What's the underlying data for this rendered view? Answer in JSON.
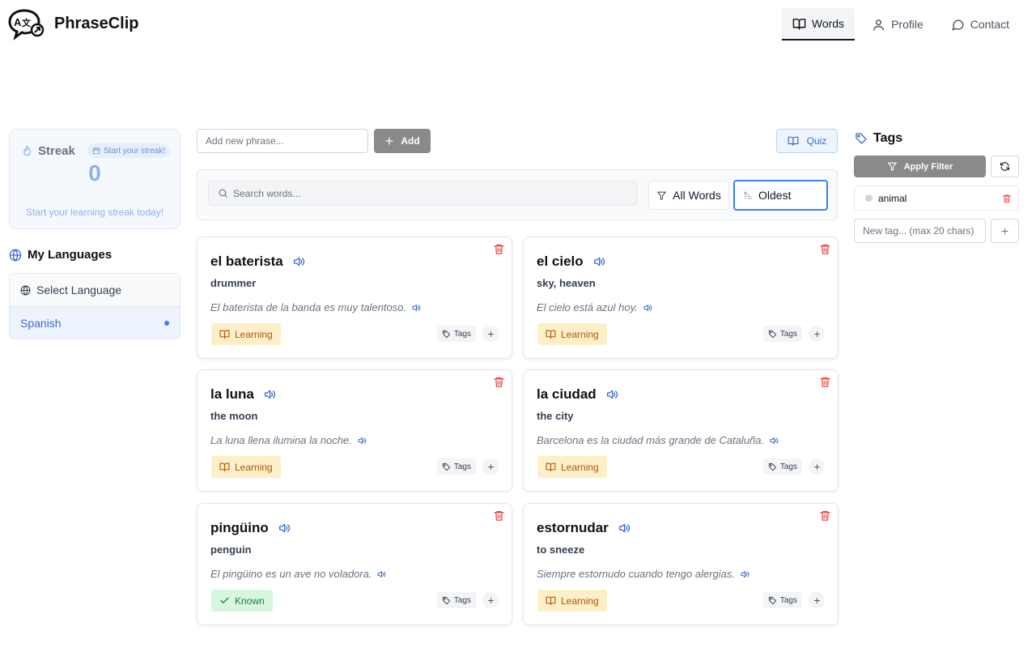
{
  "app": {
    "name": "PhraseClip"
  },
  "nav": {
    "items": [
      {
        "label": "Words",
        "icon": "book-open-icon",
        "active": true
      },
      {
        "label": "Profile",
        "icon": "user-icon",
        "active": false
      },
      {
        "label": "Contact",
        "icon": "message-circle-icon",
        "active": false
      }
    ]
  },
  "streak": {
    "title": "Streak",
    "badge": "Start your streak!",
    "count": "0",
    "message": "Start your learning streak today!"
  },
  "languages": {
    "title": "My Languages",
    "select_label": "Select Language",
    "items": [
      {
        "label": "Spanish",
        "selected": true
      }
    ]
  },
  "toolbar": {
    "add_placeholder": "Add new phrase...",
    "add_label": "Add",
    "quiz_label": "Quiz"
  },
  "filters": {
    "search_placeholder": "Search words...",
    "filter_label": "All Words",
    "sort_label": "Oldest"
  },
  "cards": [
    {
      "word": "el baterista",
      "translation": "drummer",
      "example": "El baterista de la banda es muy talentoso.",
      "status": "Learning",
      "tags_label": "Tags"
    },
    {
      "word": "el cielo",
      "translation": "sky, heaven",
      "example": "El cielo está azul hoy.",
      "status": "Learning",
      "tags_label": "Tags"
    },
    {
      "word": "la luna",
      "translation": "the moon",
      "example": "La luna llena ilumina la noche.",
      "status": "Learning",
      "tags_label": "Tags"
    },
    {
      "word": "la ciudad",
      "translation": "the city",
      "example": "Barcelona es la ciudad más grande de Cataluña.",
      "status": "Learning",
      "tags_label": "Tags"
    },
    {
      "word": "pingüino",
      "translation": "penguin",
      "example": "El pingüino es un ave no voladora.",
      "status": "Known",
      "tags_label": "Tags"
    },
    {
      "word": "estornudar",
      "translation": "to sneeze",
      "example": "Siempre estornudo cuando tengo alergias.",
      "status": "Learning",
      "tags_label": "Tags"
    }
  ],
  "tags_panel": {
    "title": "Tags",
    "apply_label": "Apply Filter",
    "tags": [
      {
        "label": "animal"
      }
    ],
    "new_tag_placeholder": "New tag... (max 20 chars)"
  },
  "colors": {
    "accent": "#3b82f6",
    "learning_bg": "#fdf0c8",
    "learning_text": "#b45309",
    "known_bg": "#d8f5e1",
    "known_text": "#15803d",
    "delete": "#ef4444",
    "button_gray": "#8a8a8a"
  }
}
